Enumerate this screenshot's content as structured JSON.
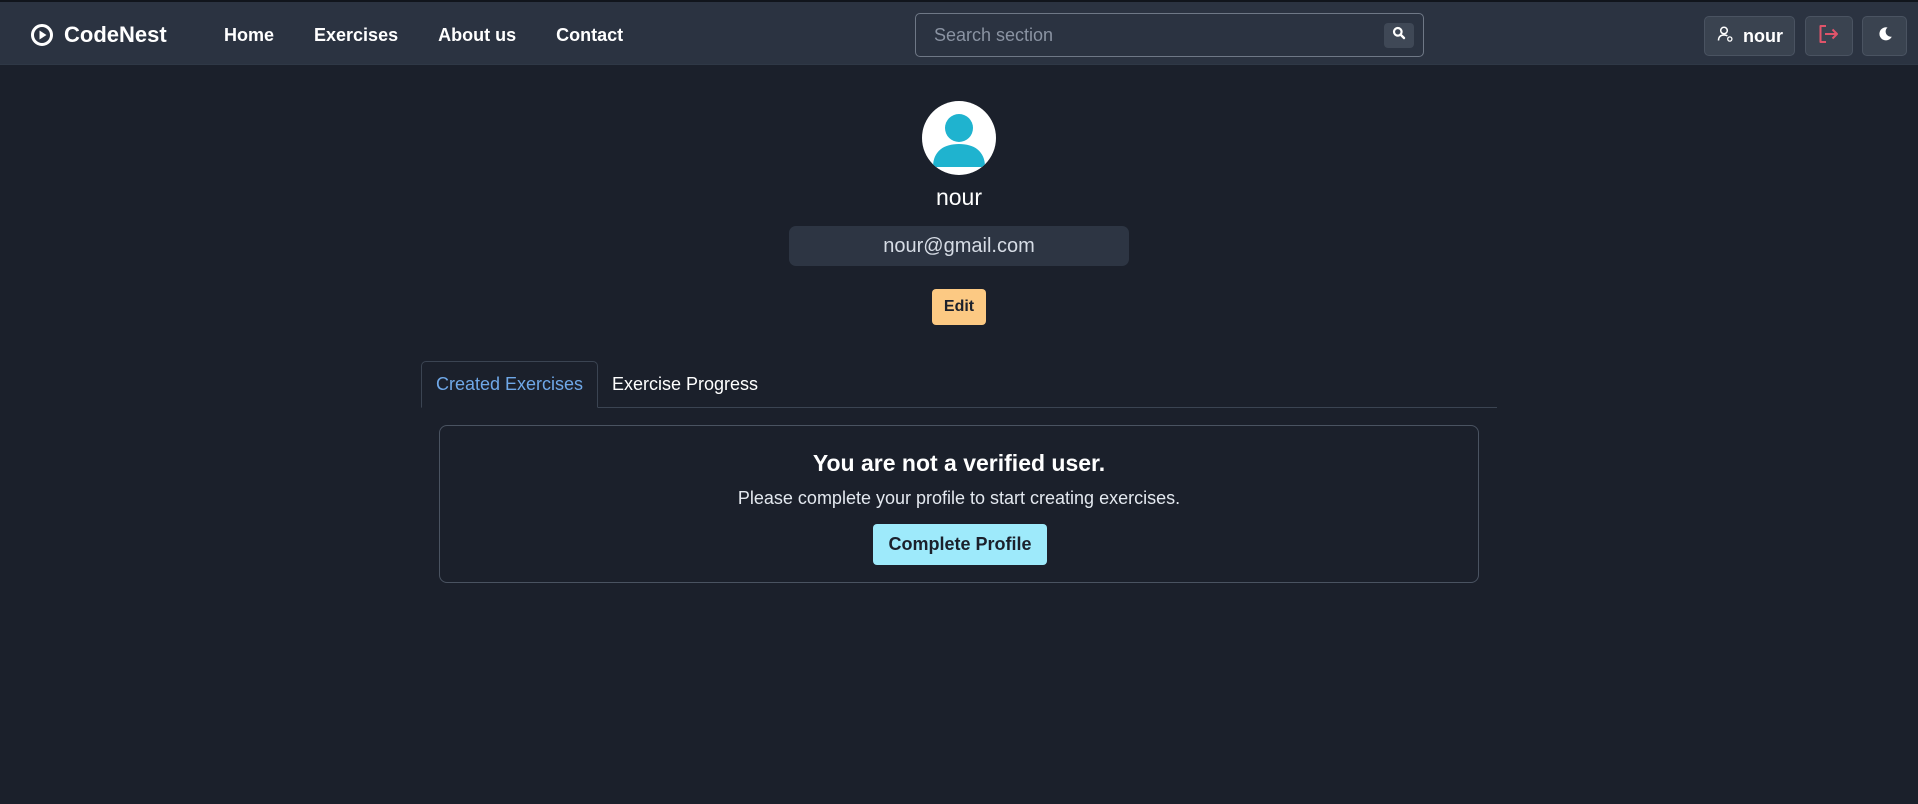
{
  "navbar": {
    "brand": "CodeNest",
    "links": [
      "Home",
      "Exercises",
      "About us",
      "Contact"
    ],
    "search_placeholder": "Search section",
    "user_label": "nour"
  },
  "profile": {
    "name": "nour",
    "email": "nour@gmail.com",
    "edit_label": "Edit"
  },
  "tabs": [
    {
      "label": "Created Exercises",
      "active": true
    },
    {
      "label": "Exercise Progress",
      "active": false
    }
  ],
  "card": {
    "title": "You are not a verified user.",
    "message": "Please complete your profile to start creating exercises.",
    "button_label": "Complete Profile"
  },
  "colors": {
    "background": "#1b202b",
    "navbar": "#2b3341",
    "active_tab": "#6fa8e8",
    "edit_button": "#fcc983",
    "complete_button": "#9eeafb",
    "logout_icon": "#e0546a",
    "avatar_figure": "#1fb3cf"
  },
  "icons": {
    "brand": "play-circle-icon",
    "search": "search-icon",
    "user": "user-icon",
    "logout": "logout-icon",
    "theme": "moon-icon"
  }
}
